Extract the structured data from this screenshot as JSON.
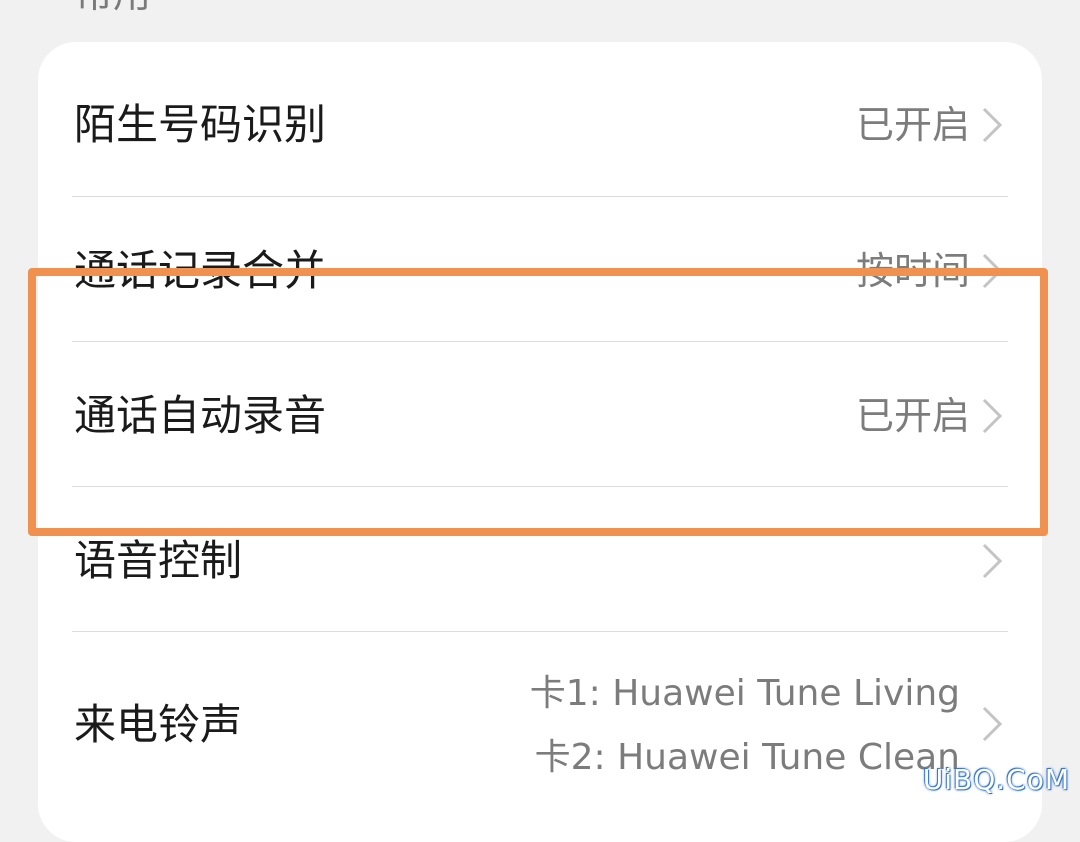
{
  "section": {
    "header": "常用"
  },
  "rows": [
    {
      "label": "陌生号码识别",
      "value": "已开启"
    },
    {
      "label": "通话记录合并",
      "value": "按时间"
    },
    {
      "label": "通话自动录音",
      "value": "已开启"
    },
    {
      "label": "语音控制",
      "value": ""
    },
    {
      "label": "来电铃声",
      "lines": [
        "卡1: Huawei Tune Living",
        "卡2: Huawei Tune Clean"
      ]
    }
  ],
  "highlight": {
    "color": "#f0914f"
  },
  "icons": {
    "chevron": "chevron-right-icon"
  },
  "watermark": "UiBQ.CoM"
}
